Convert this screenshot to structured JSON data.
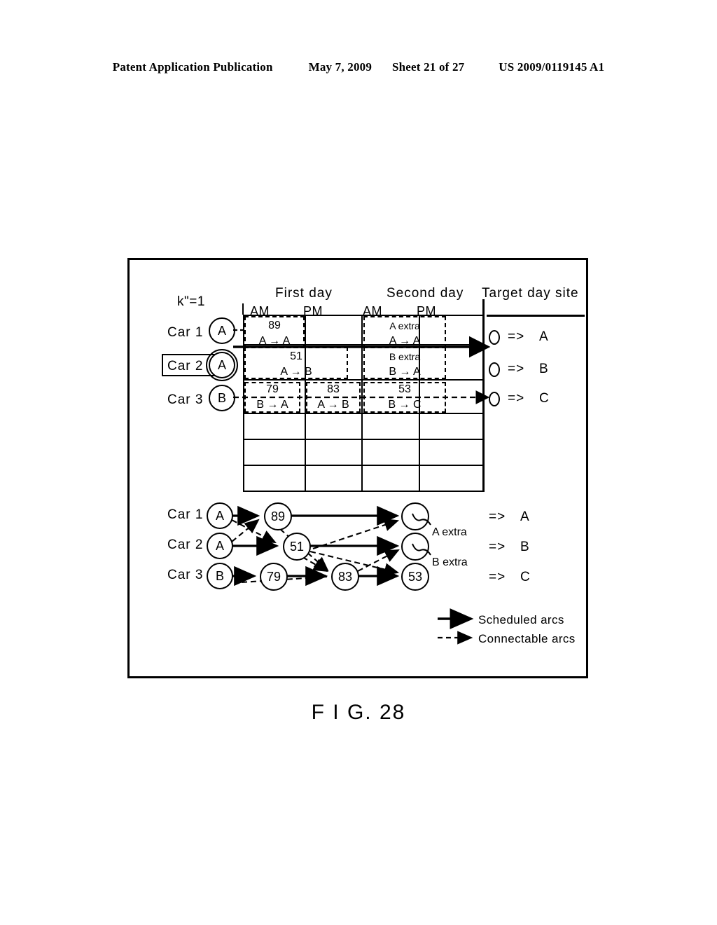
{
  "header": {
    "publication": "Patent Application Publication",
    "date": "May 7, 2009",
    "sheet": "Sheet 21 of 27",
    "patent_number": "US 2009/0119145 A1"
  },
  "figure": {
    "caption": "F I G. 28",
    "iteration_label": "k\"=1"
  },
  "table": {
    "day_headers": [
      "First day",
      "Second day",
      "Target day site"
    ],
    "period_headers": [
      "AM",
      "PM",
      "AM",
      "PM"
    ],
    "row_labels": [
      "Car 1",
      "Car 2",
      "Car 3"
    ],
    "start_nodes": [
      "A",
      "A",
      "B"
    ],
    "selected_row": "Car 2",
    "tasks": [
      {
        "row": "Car 1",
        "period": "first-am",
        "id": "89",
        "route": "A → A"
      },
      {
        "row": "Car 2",
        "period": "first-am",
        "id": "51",
        "route": "A → B"
      },
      {
        "row": "Car 3",
        "period": "first-am",
        "id": "79",
        "route": "B → A"
      },
      {
        "row": "Car 3",
        "period": "first-pm",
        "id": "83",
        "route": "A → B"
      },
      {
        "row": "Car 1",
        "period": "second-pm",
        "id": "A extra",
        "route": "A → A"
      },
      {
        "row": "Car 2",
        "period": "second-pm",
        "id": "B extra",
        "route": "B → A"
      },
      {
        "row": "Car 3",
        "period": "second-pm",
        "id": "53",
        "route": "B → C"
      }
    ],
    "target_day_site": [
      {
        "arrow": "=>",
        "site": "A"
      },
      {
        "arrow": "=>",
        "site": "B"
      },
      {
        "arrow": "=>",
        "site": "C"
      }
    ],
    "empty_rows": 3,
    "empty_columns": 4
  },
  "network": {
    "row_labels": [
      "Car 1",
      "Car 2",
      "Car 3"
    ],
    "nodes": [
      {
        "row": 0,
        "col": 0,
        "label": "A"
      },
      {
        "row": 0,
        "col": 1,
        "label": "89"
      },
      {
        "row": 0,
        "col": 3,
        "label": ""
      },
      {
        "row": 1,
        "col": 0,
        "label": "A"
      },
      {
        "row": 1,
        "col": 1,
        "label": "51"
      },
      {
        "row": 1,
        "col": 3,
        "label": ""
      },
      {
        "row": 2,
        "col": 0,
        "label": "B"
      },
      {
        "row": 2,
        "col": 1,
        "label": "79"
      },
      {
        "row": 2,
        "col": 2,
        "label": "83"
      },
      {
        "row": 2,
        "col": 3,
        "label": "53"
      }
    ],
    "annotations": [
      "A extra",
      "B extra"
    ],
    "outcomes": [
      {
        "arrow": "=>",
        "site": "A"
      },
      {
        "arrow": "=>",
        "site": "B"
      },
      {
        "arrow": "=>",
        "site": "C"
      }
    ]
  },
  "legend": {
    "items": [
      {
        "style": "solid",
        "label": "Scheduled  arcs"
      },
      {
        "style": "dashed",
        "label": "Connectable  arcs"
      }
    ]
  }
}
